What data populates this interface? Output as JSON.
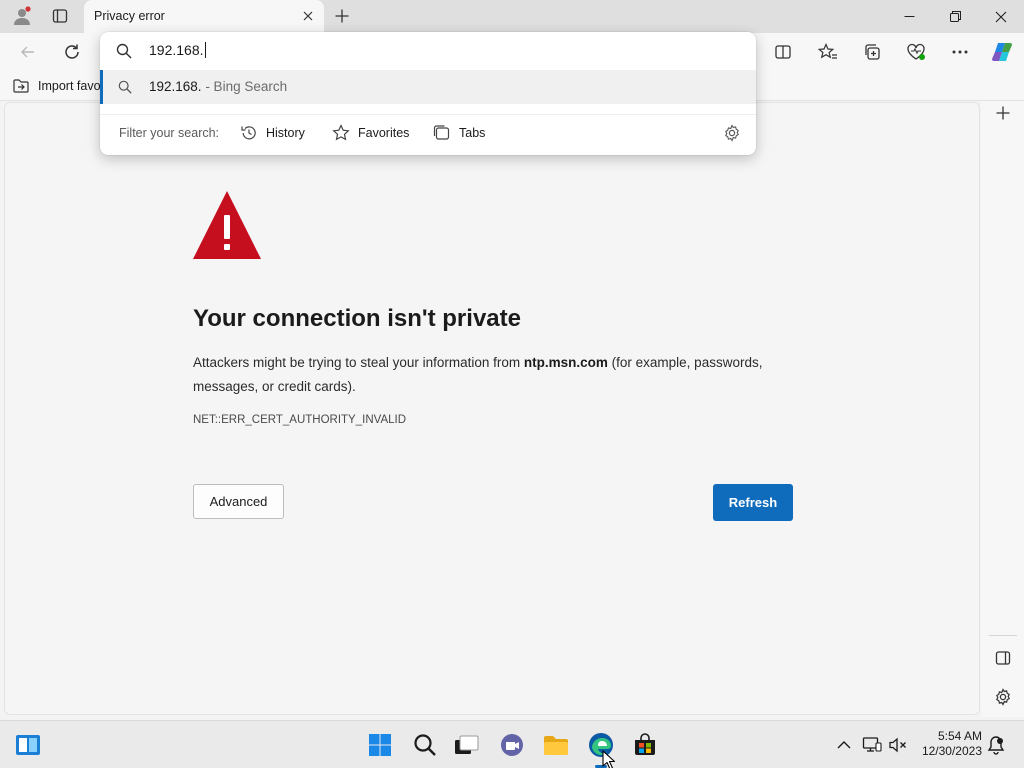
{
  "browser": {
    "tab": {
      "title": "Privacy error"
    },
    "favorites_bar": {
      "import_label": "Import favo"
    }
  },
  "address_dropdown": {
    "input_value": "192.168.",
    "suggestion": {
      "query": "192.168.",
      "suffix": " - Bing Search"
    },
    "filter": {
      "label": "Filter your search:",
      "chips": [
        {
          "label": "History",
          "icon": "history-icon"
        },
        {
          "label": "Favorites",
          "icon": "star-icon"
        },
        {
          "label": "Tabs",
          "icon": "tabs-icon"
        }
      ]
    }
  },
  "error_page": {
    "title": "Your connection isn't private",
    "description_prefix": "Attackers might be trying to steal your information from ",
    "host": "ntp.msn.com",
    "description_suffix": " (for example, passwords, messages, or credit cards).",
    "error_code": "NET::ERR_CERT_AUTHORITY_INVALID",
    "advanced_label": "Advanced",
    "refresh_label": "Refresh"
  },
  "taskbar": {
    "time": "5:54 AM",
    "date": "12/30/2023"
  },
  "colors": {
    "accent": "#0f6cbd",
    "warning_red": "#c50f1f"
  }
}
